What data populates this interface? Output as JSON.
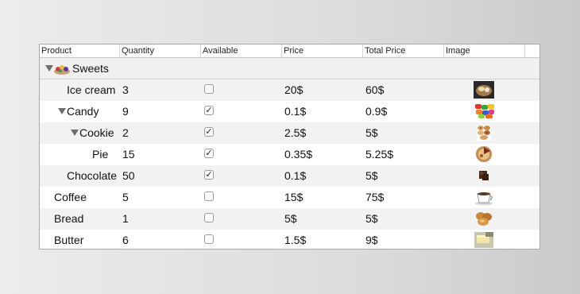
{
  "columns": [
    "Product",
    "Quantity",
    "Available",
    "Price",
    "Total Price",
    "Image"
  ],
  "group": {
    "label": "Sweets",
    "icon": "sweets-icon"
  },
  "rows": [
    {
      "product": "Ice cream",
      "quantity": "3",
      "available": false,
      "price": "20$",
      "total": "60$",
      "image": "ice-cream-icon"
    },
    {
      "product": "Candy",
      "quantity": "9",
      "available": true,
      "price": "0.1$",
      "total": "0.9$",
      "image": "candy-icon"
    },
    {
      "product": "Cookie",
      "quantity": "2",
      "available": true,
      "price": "2.5$",
      "total": "5$",
      "image": "cookie-icon"
    },
    {
      "product": "Pie",
      "quantity": "15",
      "available": true,
      "price": "0.35$",
      "total": "5.25$",
      "image": "pie-icon"
    },
    {
      "product": "Chocolate",
      "quantity": "50",
      "available": true,
      "price": "0.1$",
      "total": "5$",
      "image": "chocolate-icon"
    },
    {
      "product": "Coffee",
      "quantity": "5",
      "available": false,
      "price": "15$",
      "total": "75$",
      "image": "coffee-icon"
    },
    {
      "product": "Bread",
      "quantity": "1",
      "available": false,
      "price": "5$",
      "total": "5$",
      "image": "bread-icon"
    },
    {
      "product": "Butter",
      "quantity": "6",
      "available": false,
      "price": "1.5$",
      "total": "9$",
      "image": "butter-icon"
    }
  ],
  "colors": {
    "row_alt": "#f2f2f2",
    "group_bg": "#f0f0f0",
    "border": "#a9a9a9"
  }
}
